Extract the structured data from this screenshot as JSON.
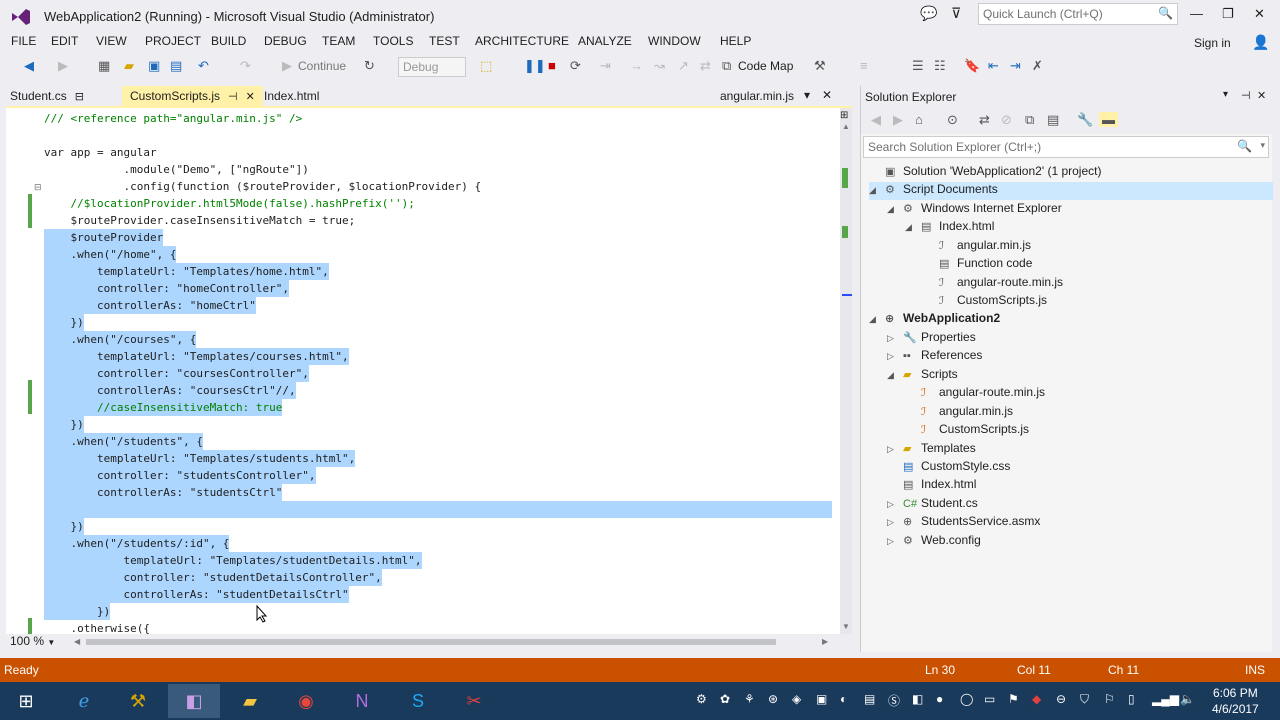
{
  "window": {
    "title": "WebApplication2 (Running) - Microsoft Visual Studio (Administrator)",
    "quick_launch": "Quick Launch (Ctrl+Q)"
  },
  "menu": [
    "FILE",
    "EDIT",
    "VIEW",
    "PROJECT",
    "BUILD",
    "DEBUG",
    "TEAM",
    "TOOLS",
    "TEST",
    "ARCHITECTURE",
    "ANALYZE",
    "WINDOW",
    "HELP"
  ],
  "signin": "Sign in",
  "toolbar": {
    "continue": "Continue",
    "config": "Debug",
    "codemap": "Code Map"
  },
  "tabs": {
    "t1": "Student.cs",
    "t2": "CustomScripts.js",
    "t3": "Index.html",
    "t4": "angular.min.js"
  },
  "editor": {
    "lines": [
      "/// <reference path=\"angular.min.js\" />",
      "",
      "var app = angular",
      "            .module(\"Demo\", [\"ngRoute\"])",
      "            .config(function ($routeProvider, $locationProvider) {",
      "    //$locationProvider.html5Mode(false).hashPrefix('');",
      "    $routeProvider.caseInsensitiveMatch = true;",
      "    $routeProvider",
      "    .when(\"/home\", {",
      "        templateUrl: \"Templates/home.html\",",
      "        controller: \"homeController\",",
      "        controllerAs: \"homeCtrl\"",
      "    })",
      "    .when(\"/courses\", {",
      "        templateUrl: \"Templates/courses.html\",",
      "        controller: \"coursesController\",",
      "        controllerAs: \"coursesCtrl\"//,",
      "        //caseInsensitiveMatch: true",
      "    })",
      "    .when(\"/students\", {",
      "        templateUrl: \"Templates/students.html\",",
      "        controller: \"studentsController\",",
      "        controllerAs: \"studentsCtrl\"",
      "",
      "    })",
      "    .when(\"/students/:id\", {",
      "            templateUrl: \"Templates/studentDetails.html\",",
      "            controller: \"studentDetailsController\",",
      "            controllerAs: \"studentDetailsCtrl\"",
      "        })",
      "    .otherwise({"
    ],
    "zoom": "100 %"
  },
  "solution_explorer": {
    "title": "Solution Explorer",
    "search": "Search Solution Explorer (Ctrl+;)",
    "items": [
      "Solution 'WebApplication2' (1 project)",
      "Script Documents",
      "Windows Internet Explorer",
      "Index.html",
      "angular.min.js",
      "Function code",
      "angular-route.min.js",
      "CustomScripts.js",
      "WebApplication2",
      "Properties",
      "References",
      "Scripts",
      "angular-route.min.js",
      "angular.min.js",
      "CustomScripts.js",
      "Templates",
      "CustomStyle.css",
      "Index.html",
      "Student.cs",
      "StudentsService.asmx",
      "Web.config"
    ]
  },
  "status": {
    "ready": "Ready",
    "ln": "Ln 30",
    "col": "Col 11",
    "ch": "Ch 11",
    "ins": "INS"
  },
  "clock": {
    "time": "6:06 PM",
    "date": "4/6/2017"
  },
  "colors": {
    "accent": "#68217a",
    "status": "#ca5100",
    "selection": "#add6ff",
    "active_tab": "#fff1a8"
  }
}
